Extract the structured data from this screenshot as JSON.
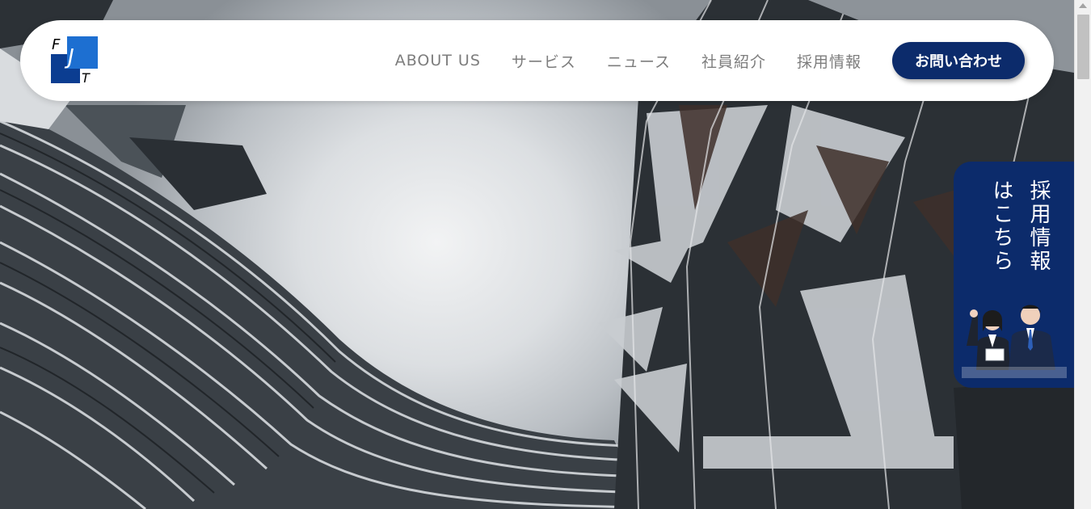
{
  "header": {
    "logo_icon": "fjt-logo-icon",
    "logo_letters": [
      "F",
      "J",
      "T"
    ],
    "nav": [
      {
        "label": "ABOUT US"
      },
      {
        "label": "サービス"
      },
      {
        "label": "ニュース"
      },
      {
        "label": "社員紹介"
      },
      {
        "label": "採用情報"
      }
    ],
    "contact_label": "お問い合わせ"
  },
  "recruit_tab": {
    "label": "採用情報はこちら",
    "image_icon": "recruit-staff-illustration"
  },
  "hero": {
    "image": "building-architecture-upward-view"
  },
  "colors": {
    "brand": "#0c2b6b",
    "nav_text": "#7d7d7d",
    "header_bg": "#ffffff",
    "logo_blue": "#1d6fd1"
  }
}
